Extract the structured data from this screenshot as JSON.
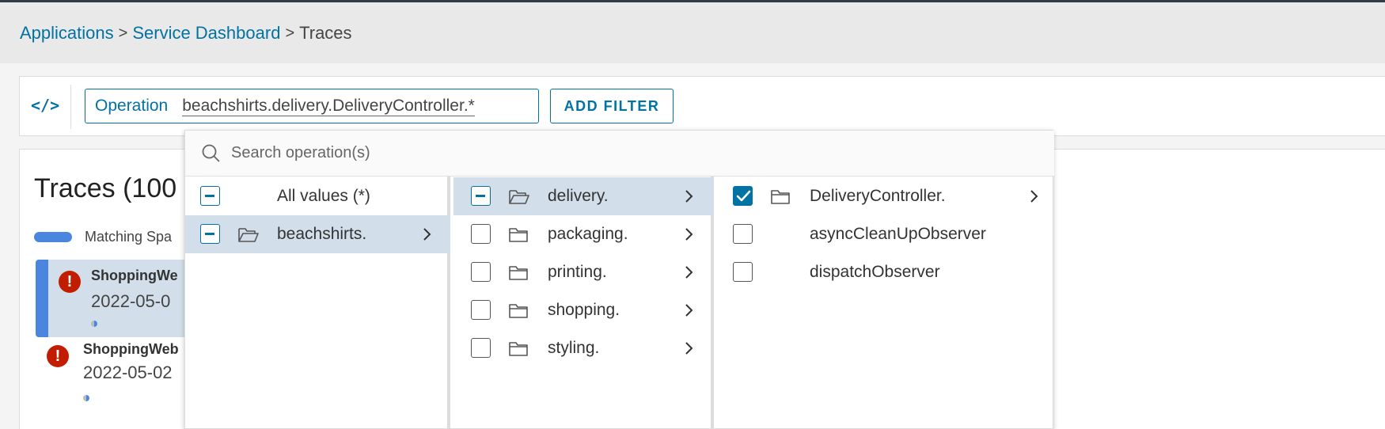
{
  "breadcrumb": {
    "items": [
      "Applications",
      "Service Dashboard"
    ],
    "current": "Traces",
    "separator": ">"
  },
  "filterbar": {
    "code_toggle": "</>",
    "operation_key": "Operation",
    "operation_value": "beachshirts.delivery.DeliveryController.*",
    "add_filter": "ADD FILTER"
  },
  "traces": {
    "title": "Traces (100",
    "legend_label": "Matching Spa",
    "rows": [
      {
        "service": "ShoppingWe",
        "date": "2022-05-0",
        "error": "!"
      },
      {
        "service": "ShoppingWeb",
        "date": "2022-05-02",
        "error": "!"
      }
    ]
  },
  "dropdown": {
    "search_placeholder": "Search operation(s)",
    "col1": [
      {
        "label": "All values (*)",
        "state": "partial",
        "folder": false,
        "chevron": false,
        "active": false
      },
      {
        "label": "beachshirts.",
        "state": "partial",
        "folder": true,
        "open": true,
        "chevron": true,
        "active": true
      }
    ],
    "col2": [
      {
        "label": "delivery.",
        "state": "partial",
        "folder": true,
        "open": true,
        "chevron": true,
        "active": true
      },
      {
        "label": "packaging.",
        "state": "unchecked",
        "folder": true,
        "chevron": true,
        "active": false
      },
      {
        "label": "printing.",
        "state": "unchecked",
        "folder": true,
        "chevron": true,
        "active": false
      },
      {
        "label": "shopping.",
        "state": "unchecked",
        "folder": true,
        "chevron": true,
        "active": false
      },
      {
        "label": "styling.",
        "state": "unchecked",
        "folder": true,
        "chevron": true,
        "active": false
      }
    ],
    "col3": [
      {
        "label": "DeliveryController.",
        "state": "checked",
        "folder": true,
        "chevron": true,
        "active": false
      },
      {
        "label": "asyncCleanUpObserver",
        "state": "unchecked",
        "folder": false,
        "chevron": false,
        "active": false
      },
      {
        "label": "dispatchObserver",
        "state": "unchecked",
        "folder": false,
        "chevron": false,
        "active": false
      }
    ]
  },
  "colors": {
    "accent": "#0072a3",
    "selected_row": "#d2dfea",
    "error": "#c21d00",
    "bar": "#4a86e0"
  }
}
